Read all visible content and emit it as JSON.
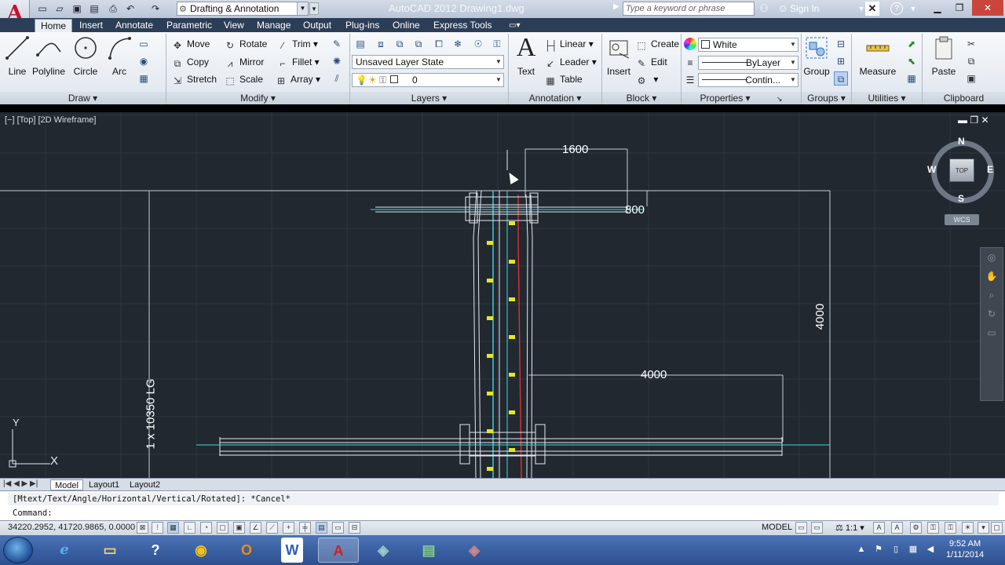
{
  "title_bar": {
    "workspace": "Drafting & Annotation",
    "window_title": "AutoCAD 2012    Drawing1.dwg",
    "search_placeholder": "Type a keyword or phrase",
    "sign_in": "Sign In"
  },
  "ribbon_tabs": [
    "Home",
    "Insert",
    "Annotate",
    "Parametric",
    "View",
    "Manage",
    "Output",
    "Plug-ins",
    "Online",
    "Express Tools"
  ],
  "draw_panel": {
    "title": "Draw",
    "tools": [
      "Line",
      "Polyline",
      "Circle",
      "Arc"
    ]
  },
  "modify_panel": {
    "title": "Modify",
    "tools": [
      "Move",
      "Rotate",
      "Trim",
      "Copy",
      "Mirror",
      "Fillet",
      "Stretch",
      "Scale",
      "Array"
    ]
  },
  "layers_panel": {
    "title": "Layers",
    "layer_state": "Unsaved Layer State",
    "current_layer": "0"
  },
  "annotation_panel": {
    "title": "Annotation",
    "text": "Text",
    "linear": "Linear",
    "leader": "Leader",
    "table": "Table"
  },
  "block_panel": {
    "title": "Block",
    "insert": "Insert",
    "create": "Create",
    "edit": "Edit"
  },
  "properties_panel": {
    "title": "Properties",
    "color": "White",
    "lineweight": "ByLayer",
    "linetype": "Contin..."
  },
  "groups_panel": {
    "title": "Groups",
    "group": "Group"
  },
  "utilities_panel": {
    "title": "Utilities",
    "measure": "Measure"
  },
  "clipboard_panel": {
    "title": "Clipboard",
    "paste": "Paste"
  },
  "viewport": {
    "label": "[−] [Top] [2D Wireframe]"
  },
  "viewcube": {
    "n": "N",
    "s": "S",
    "e": "E",
    "w": "W",
    "top": "TOP",
    "wcs": "WCS"
  },
  "drawing": {
    "dim_top": "1600",
    "dim_small": "800",
    "dim_right": "4000",
    "dim_mid": "4000",
    "dim_left": "1 x 10350 LG"
  },
  "ucs": {
    "x": "X",
    "y": "Y"
  },
  "layout_tabs": [
    "Model",
    "Layout1",
    "Layout2"
  ],
  "command": {
    "history": "[Mtext/Text/Angle/Horizontal/Vertical/Rotated]: *Cancel*",
    "prompt": "Command:"
  },
  "status": {
    "coords": "34220.2952, 41720.9865, 0.0000",
    "model": "MODEL",
    "scale": "1:1"
  },
  "taskbar": {
    "time": "9:52 AM",
    "date": "1/11/2014"
  },
  "colors": {
    "canvas": "#212830",
    "ribbon_tab_bar": "#2c3e57",
    "dim_text": "#ffffff",
    "cyan_line": "#3fd8e0",
    "red_line": "#e03030",
    "yellow_bolt": "#e6e620"
  }
}
